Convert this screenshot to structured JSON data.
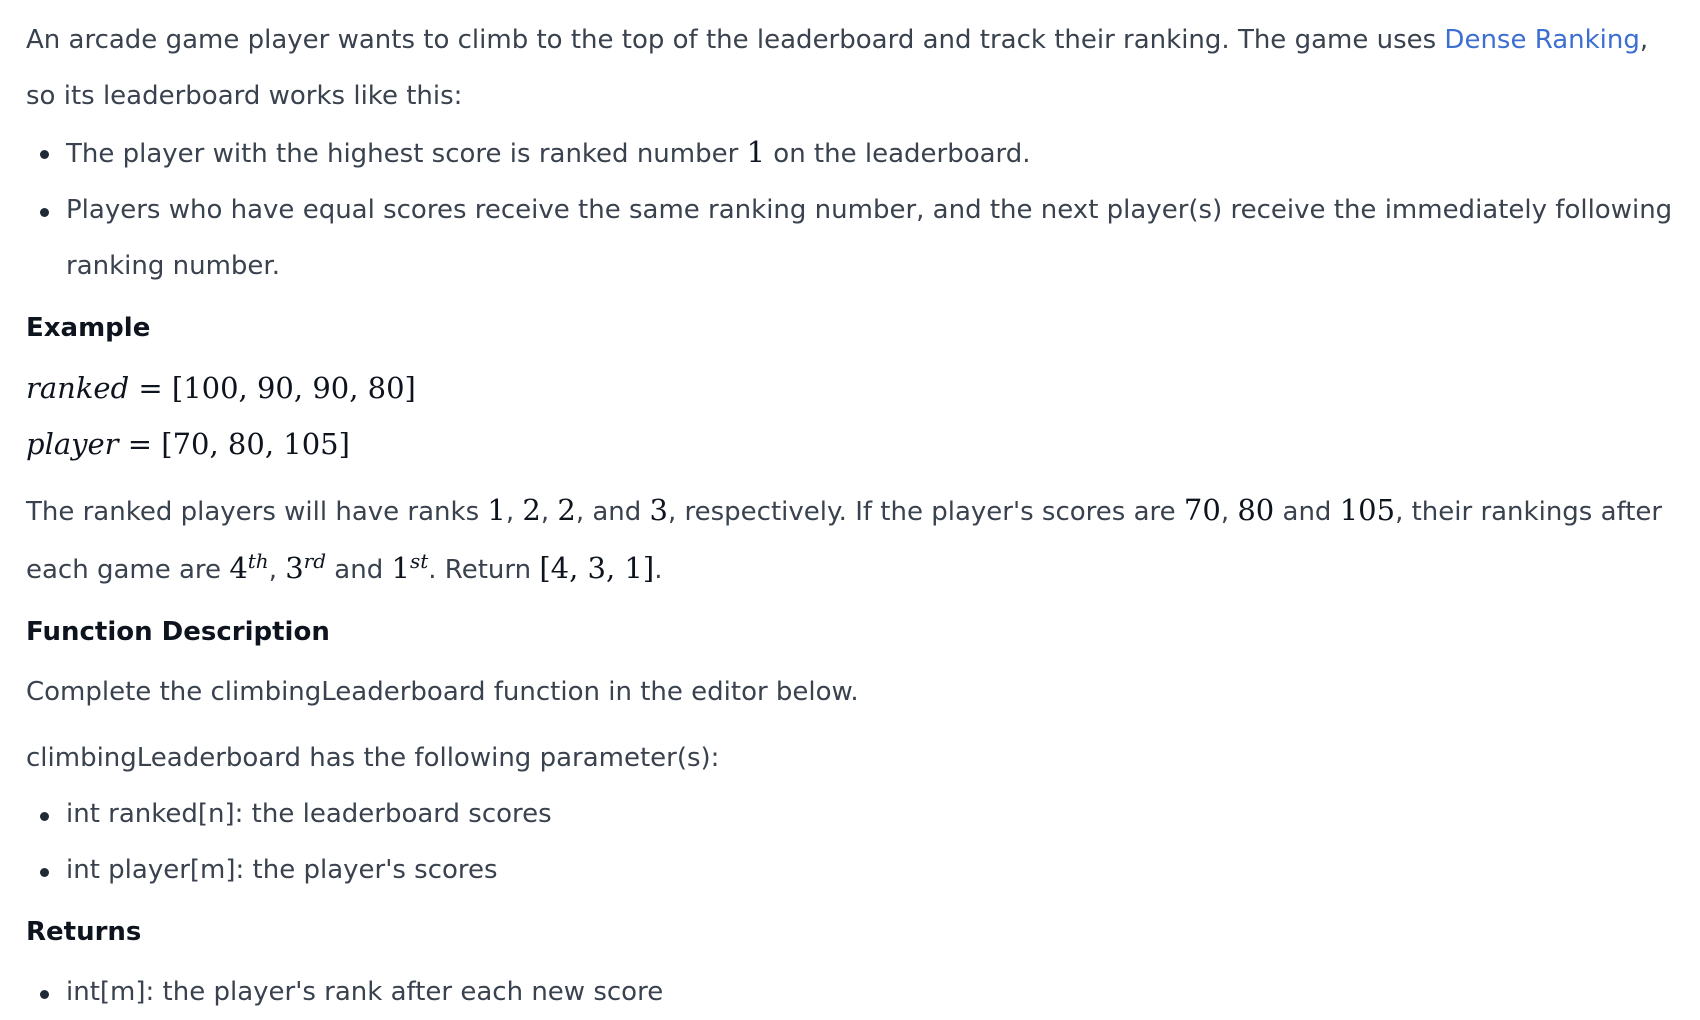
{
  "intro": {
    "text_before": "An arcade game player wants to climb to the top of the leaderboard and track their ranking. The game uses ",
    "link": "Dense Ranking",
    "text_after": ", so its leaderboard works like this:"
  },
  "rules": {
    "r1_before": "The player with the highest score is ranked number ",
    "r1_num": "1",
    "r1_after": " on the leaderboard.",
    "r2": "Players who have equal scores receive the same ranking number, and the next player(s) receive the immediately following ranking number."
  },
  "example": {
    "heading": "Example",
    "ranked_var": "ranked",
    "ranked_val": "= [100, 90, 90, 80]",
    "player_var": "player",
    "player_val": "= [70, 80, 105]",
    "expl": {
      "t1": "The ranked players will have ranks ",
      "m1": "1",
      "c1": ", ",
      "m2": "2",
      "c2": ", ",
      "m3": "2",
      "t2": ", and ",
      "m4": "3",
      "t3": ", respectively. If the player's scores are ",
      "m5": "70",
      "c3": ", ",
      "m6": "80",
      "t4": " and ",
      "m7": "105",
      "t5": ", their rankings after each game are ",
      "m8": "4",
      "s8": "th",
      "c4": ", ",
      "m9": "3",
      "s9": "rd",
      "t6": " and ",
      "m10": "1",
      "s10": "st",
      "t7": ". Return ",
      "m11": "[4, 3, 1]",
      "t8": "."
    }
  },
  "function_desc": {
    "heading": "Function Description",
    "line1": "Complete the climbingLeaderboard function in the editor below.",
    "line2": "climbingLeaderboard has the following parameter(s):",
    "params": [
      "int ranked[n]: the leaderboard scores",
      "int player[m]: the player's scores"
    ]
  },
  "returns": {
    "heading": "Returns",
    "items": [
      "int[m]: the player's rank after each new score"
    ]
  }
}
